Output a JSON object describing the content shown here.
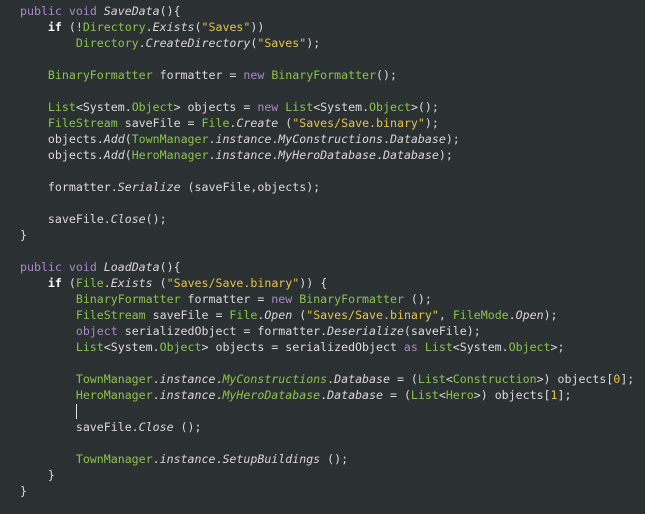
{
  "editor": {
    "colors": {
      "background": "#2b3033",
      "keyword": "#a88ac4",
      "type": "#8bc34a",
      "string": "#e6c545",
      "text": "#dadada"
    },
    "cursor_line": 26,
    "lines": [
      [
        [
          "k",
          "public"
        ],
        [
          "p",
          " "
        ],
        [
          "k",
          "void"
        ],
        [
          "p",
          " "
        ],
        [
          "i",
          "SaveData"
        ],
        [
          "p",
          "(){"
        ]
      ],
      [
        [
          "p",
          "    "
        ],
        [
          "b",
          "if"
        ],
        [
          "p",
          " (!"
        ],
        [
          "t",
          "Directory"
        ],
        [
          "p",
          "."
        ],
        [
          "i",
          "Exists"
        ],
        [
          "p",
          "("
        ],
        [
          "s",
          "\"Saves\""
        ],
        [
          "p",
          "))"
        ]
      ],
      [
        [
          "p",
          "        "
        ],
        [
          "t",
          "Directory"
        ],
        [
          "p",
          "."
        ],
        [
          "i",
          "CreateDirectory"
        ],
        [
          "p",
          "("
        ],
        [
          "s",
          "\"Saves\""
        ],
        [
          "p",
          ");"
        ]
      ],
      [],
      [
        [
          "p",
          "    "
        ],
        [
          "t",
          "BinaryFormatter"
        ],
        [
          "p",
          " formatter = "
        ],
        [
          "k",
          "new"
        ],
        [
          "p",
          " "
        ],
        [
          "t",
          "BinaryFormatter"
        ],
        [
          "p",
          "();"
        ]
      ],
      [],
      [
        [
          "p",
          "    "
        ],
        [
          "t",
          "List"
        ],
        [
          "p",
          "<System."
        ],
        [
          "t",
          "Object"
        ],
        [
          "p",
          "> objects = "
        ],
        [
          "k",
          "new"
        ],
        [
          "p",
          " "
        ],
        [
          "t",
          "List"
        ],
        [
          "p",
          "<System."
        ],
        [
          "t",
          "Object"
        ],
        [
          "p",
          ">();"
        ]
      ],
      [
        [
          "p",
          "    "
        ],
        [
          "t",
          "FileStream"
        ],
        [
          "p",
          " saveFile = "
        ],
        [
          "t",
          "File"
        ],
        [
          "p",
          "."
        ],
        [
          "i",
          "Create"
        ],
        [
          "p",
          " ("
        ],
        [
          "s",
          "\"Saves/Save.binary\""
        ],
        [
          "p",
          ");"
        ]
      ],
      [
        [
          "p",
          "    objects."
        ],
        [
          "i",
          "Add"
        ],
        [
          "p",
          "("
        ],
        [
          "t",
          "TownManager"
        ],
        [
          "p",
          "."
        ],
        [
          "i",
          "instance"
        ],
        [
          "p",
          "."
        ],
        [
          "i",
          "MyConstructions"
        ],
        [
          "p",
          "."
        ],
        [
          "i",
          "Database"
        ],
        [
          "p",
          ");"
        ]
      ],
      [
        [
          "p",
          "    objects."
        ],
        [
          "i",
          "Add"
        ],
        [
          "p",
          "("
        ],
        [
          "t",
          "HeroManager"
        ],
        [
          "p",
          "."
        ],
        [
          "i",
          "instance"
        ],
        [
          "p",
          "."
        ],
        [
          "i",
          "MyHeroDatabase"
        ],
        [
          "p",
          "."
        ],
        [
          "i",
          "Database"
        ],
        [
          "p",
          ");"
        ]
      ],
      [],
      [
        [
          "p",
          "    formatter."
        ],
        [
          "i",
          "Serialize"
        ],
        [
          "p",
          " (saveFile,objects);"
        ]
      ],
      [],
      [
        [
          "p",
          "    saveFile."
        ],
        [
          "i",
          "Close"
        ],
        [
          "p",
          "();"
        ]
      ],
      [
        [
          "p",
          "}"
        ]
      ],
      [],
      [
        [
          "k",
          "public"
        ],
        [
          "p",
          " "
        ],
        [
          "k",
          "void"
        ],
        [
          "p",
          " "
        ],
        [
          "i",
          "LoadData"
        ],
        [
          "p",
          "(){"
        ]
      ],
      [
        [
          "p",
          "    "
        ],
        [
          "b",
          "if"
        ],
        [
          "p",
          " ("
        ],
        [
          "t",
          "File"
        ],
        [
          "p",
          "."
        ],
        [
          "i",
          "Exists"
        ],
        [
          "p",
          " ("
        ],
        [
          "s",
          "\"Saves/Save.binary\""
        ],
        [
          "p",
          ")) {"
        ]
      ],
      [
        [
          "p",
          "        "
        ],
        [
          "t",
          "BinaryFormatter"
        ],
        [
          "p",
          " formatter = "
        ],
        [
          "k",
          "new"
        ],
        [
          "p",
          " "
        ],
        [
          "t",
          "BinaryFormatter"
        ],
        [
          "p",
          " ();"
        ]
      ],
      [
        [
          "p",
          "        "
        ],
        [
          "t",
          "FileStream"
        ],
        [
          "p",
          " saveFile = "
        ],
        [
          "t",
          "File"
        ],
        [
          "p",
          "."
        ],
        [
          "i",
          "Open"
        ],
        [
          "p",
          " ("
        ],
        [
          "s",
          "\"Saves/Save.binary\""
        ],
        [
          "p",
          ", "
        ],
        [
          "t",
          "FileMode"
        ],
        [
          "p",
          "."
        ],
        [
          "i",
          "Open"
        ],
        [
          "p",
          ");"
        ]
      ],
      [
        [
          "p",
          "        "
        ],
        [
          "k",
          "object"
        ],
        [
          "p",
          " serializedObject = formatter."
        ],
        [
          "i",
          "Deserialize"
        ],
        [
          "p",
          "(saveFile);"
        ]
      ],
      [
        [
          "p",
          "        "
        ],
        [
          "t",
          "List"
        ],
        [
          "p",
          "<System."
        ],
        [
          "t",
          "Object"
        ],
        [
          "p",
          "> objects = serializedObject "
        ],
        [
          "k",
          "as"
        ],
        [
          "p",
          " "
        ],
        [
          "t",
          "List"
        ],
        [
          "p",
          "<System."
        ],
        [
          "t",
          "Object"
        ],
        [
          "p",
          ">;"
        ]
      ],
      [],
      [
        [
          "p",
          "        "
        ],
        [
          "t",
          "TownManager"
        ],
        [
          "p",
          "."
        ],
        [
          "i",
          "instance"
        ],
        [
          "p",
          "."
        ],
        [
          "ti",
          "MyConstructions"
        ],
        [
          "p",
          "."
        ],
        [
          "i",
          "Database"
        ],
        [
          "p",
          " = ("
        ],
        [
          "t",
          "List"
        ],
        [
          "p",
          "<"
        ],
        [
          "t",
          "Construction"
        ],
        [
          "p",
          ">) objects["
        ],
        [
          "n",
          "0"
        ],
        [
          "p",
          "];"
        ]
      ],
      [
        [
          "p",
          "        "
        ],
        [
          "t",
          "HeroManager"
        ],
        [
          "p",
          "."
        ],
        [
          "i",
          "instance"
        ],
        [
          "p",
          "."
        ],
        [
          "ti",
          "MyHeroDatabase"
        ],
        [
          "p",
          "."
        ],
        [
          "i",
          "Database"
        ],
        [
          "p",
          " = ("
        ],
        [
          "t",
          "List"
        ],
        [
          "p",
          "<"
        ],
        [
          "t",
          "Hero"
        ],
        [
          "p",
          ">) objects["
        ],
        [
          "n",
          "1"
        ],
        [
          "p",
          "];"
        ]
      ],
      [
        [
          "p",
          "        "
        ]
      ],
      [
        [
          "p",
          "        saveFile."
        ],
        [
          "i",
          "Close"
        ],
        [
          "p",
          " ();"
        ]
      ],
      [],
      [
        [
          "p",
          "        "
        ],
        [
          "t",
          "TownManager"
        ],
        [
          "p",
          "."
        ],
        [
          "i",
          "instance"
        ],
        [
          "p",
          "."
        ],
        [
          "i",
          "SetupBuildings"
        ],
        [
          "p",
          " ();"
        ]
      ],
      [
        [
          "p",
          "    }"
        ]
      ],
      [
        [
          "p",
          "}"
        ]
      ]
    ]
  }
}
